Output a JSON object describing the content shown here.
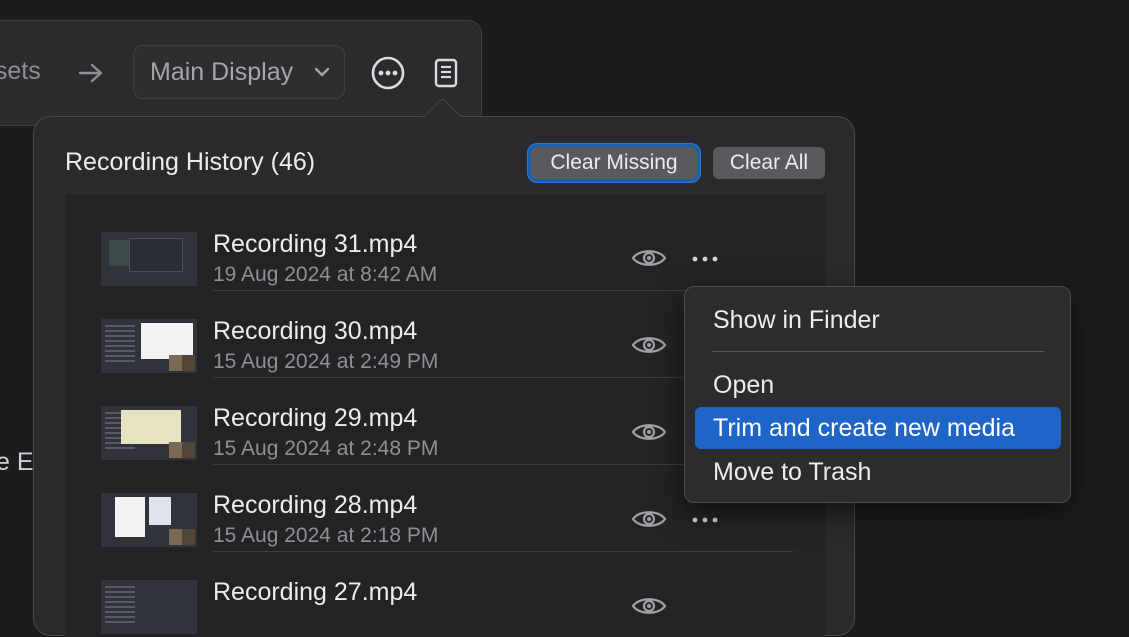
{
  "toolbar": {
    "presets_label": "esets",
    "display_select": "Main Display",
    "more_icon": "ellipsis-circle-icon",
    "history_icon": "document-list-icon"
  },
  "left_edge_text": "e E",
  "popover": {
    "title": "Recording History (46)",
    "clear_missing_label": "Clear Missing",
    "clear_all_label": "Clear All",
    "recordings": [
      {
        "name": "Recording 31.mp4",
        "date": "19 Aug 2024 at 8:42 AM"
      },
      {
        "name": "Recording 30.mp4",
        "date": "15 Aug 2024 at 2:49 PM"
      },
      {
        "name": "Recording 29.mp4",
        "date": "15 Aug 2024 at 2:48 PM"
      },
      {
        "name": "Recording 28.mp4",
        "date": "15 Aug 2024 at 2:18 PM"
      },
      {
        "name": "Recording 27.mp4",
        "date": ""
      }
    ]
  },
  "context_menu": {
    "items": [
      {
        "label": "Show in Finder"
      },
      {
        "label": "Open"
      },
      {
        "label": "Trim and create new media",
        "highlighted": true
      },
      {
        "label": "Move to Trash"
      }
    ]
  },
  "colors": {
    "accent": "#1f65c7",
    "focus_ring": "#2b7bd6",
    "background": "#1c1c1f"
  }
}
